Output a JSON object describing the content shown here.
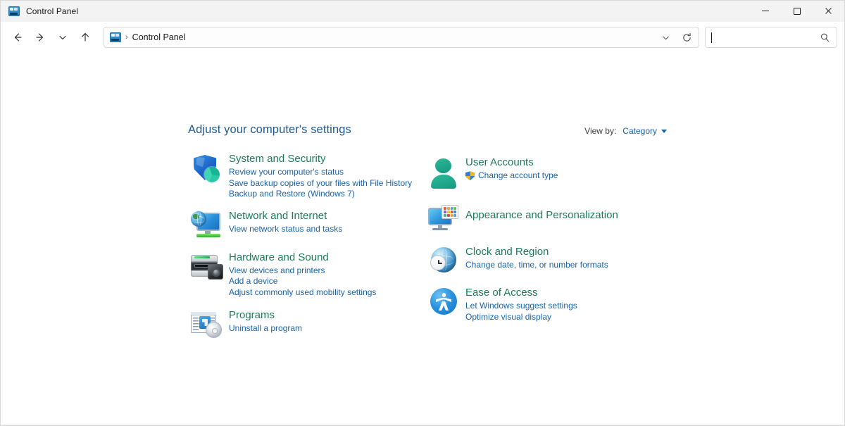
{
  "window": {
    "title": "Control Panel",
    "app_icon": "control-panel-icon",
    "controls": {
      "minimize": "Minimize",
      "maximize": "Maximize",
      "close": "Close"
    }
  },
  "nav": {
    "back": "Back",
    "forward": "Forward",
    "recent": "Recent locations",
    "up": "Up",
    "address": {
      "icon": "control-panel-icon",
      "separator": "›",
      "path": "Control Panel",
      "dropdown": "Previous locations",
      "refresh": "Refresh"
    },
    "search": {
      "value": "",
      "placeholder": "",
      "icon": "search-icon"
    }
  },
  "main": {
    "heading": "Adjust your computer's settings",
    "view_by": {
      "label": "View by:",
      "value": "Category"
    },
    "left_column": [
      {
        "icon": "shield-icon",
        "title": "System and Security",
        "links": [
          {
            "text": "Review your computer's status"
          },
          {
            "text": "Save backup copies of your files with File History"
          },
          {
            "text": "Backup and Restore (Windows 7)"
          }
        ]
      },
      {
        "icon": "network-monitor-globe-icon",
        "title": "Network and Internet",
        "links": [
          {
            "text": "View network status and tasks"
          }
        ]
      },
      {
        "icon": "printer-speaker-icon",
        "title": "Hardware and Sound",
        "links": [
          {
            "text": "View devices and printers"
          },
          {
            "text": "Add a device"
          },
          {
            "text": "Adjust commonly used mobility settings"
          }
        ]
      },
      {
        "icon": "programs-disc-icon",
        "title": "Programs",
        "links": [
          {
            "text": "Uninstall a program"
          }
        ]
      }
    ],
    "right_column": [
      {
        "icon": "user-account-icon",
        "title": "User Accounts",
        "links": [
          {
            "text": "Change account type",
            "shield": true
          }
        ]
      },
      {
        "icon": "appearance-monitor-icon",
        "title": "Appearance and Personalization",
        "links": []
      },
      {
        "icon": "clock-globe-icon",
        "title": "Clock and Region",
        "links": [
          {
            "text": "Change date, time, or number formats"
          }
        ]
      },
      {
        "icon": "ease-of-access-icon",
        "title": "Ease of Access",
        "links": [
          {
            "text": "Let Windows suggest settings"
          },
          {
            "text": "Optimize visual display"
          }
        ]
      }
    ]
  },
  "colors": {
    "heading_blue": "#1e5a8e",
    "category_green": "#1b7a5a",
    "link_blue": "#1a62a8",
    "titlebar_bg": "#f3f3f3",
    "content_bg": "#ffffff"
  }
}
